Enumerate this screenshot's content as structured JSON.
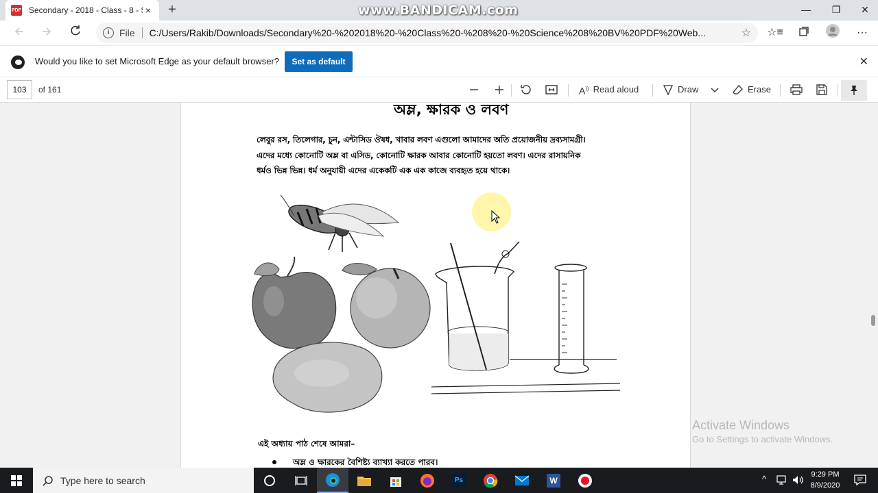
{
  "tab": {
    "title": "Secondary - 2018 - Class - 8 - Sc",
    "favicon": "PDF",
    "close": "×"
  },
  "recorder_watermark": "www.BANDICAM.com",
  "window": {
    "minimize": "—",
    "maximize": "❐",
    "close": "✕"
  },
  "address": {
    "scheme": "File",
    "url": "C:/Users/Rakib/Downloads/Secondary%20-%202018%20-%20Class%20-%208%20-%20Science%208%20BV%20PDF%20Web..."
  },
  "infobar": {
    "message": "Would you like to set Microsoft Edge as your default browser?",
    "button": "Set as default"
  },
  "pdf_toolbar": {
    "page_number": "103",
    "page_total": "of 161",
    "read_aloud": "Read aloud",
    "draw": "Draw",
    "erase": "Erase"
  },
  "document": {
    "chapter_title": "অম্ল, ক্ষারক ও লবণ",
    "intro_line1": "লেবুর রস, তিলেগার, চুন, এন্টাসিড ঔষধ, খাবার লবণ এগুলো আমাদের অতি প্রয়োজনীয় দ্রব্যসামগ্রী।",
    "intro_line2": "এদের মধ্যে কোনোটি অম্ল বা এসিড, কোনোটি ক্ষারক আবার কোনোটি হয়তো লবণ। এদের রাসায়নিক",
    "intro_line3": "ধর্মও ভিন্ন ভিন্ন। ধর্ম অনুযায়ী এদের একেকটি এক এক কাজে ব্যবহৃত হয়ে থাকে।",
    "section_heading": "এই অধ্যায় পাঠ শেষে আমরা–",
    "bullet1": "অম্ল ও ক্ষারকের বৈশিষ্ট্য ব্যাখ্যা করতে পারব।"
  },
  "os_watermark": {
    "line1": "Activate Windows",
    "line2": "Go to Settings to activate Windows."
  },
  "taskbar": {
    "search_placeholder": "Type here to search",
    "time": "9:29 PM",
    "date": "8/9/2020"
  }
}
